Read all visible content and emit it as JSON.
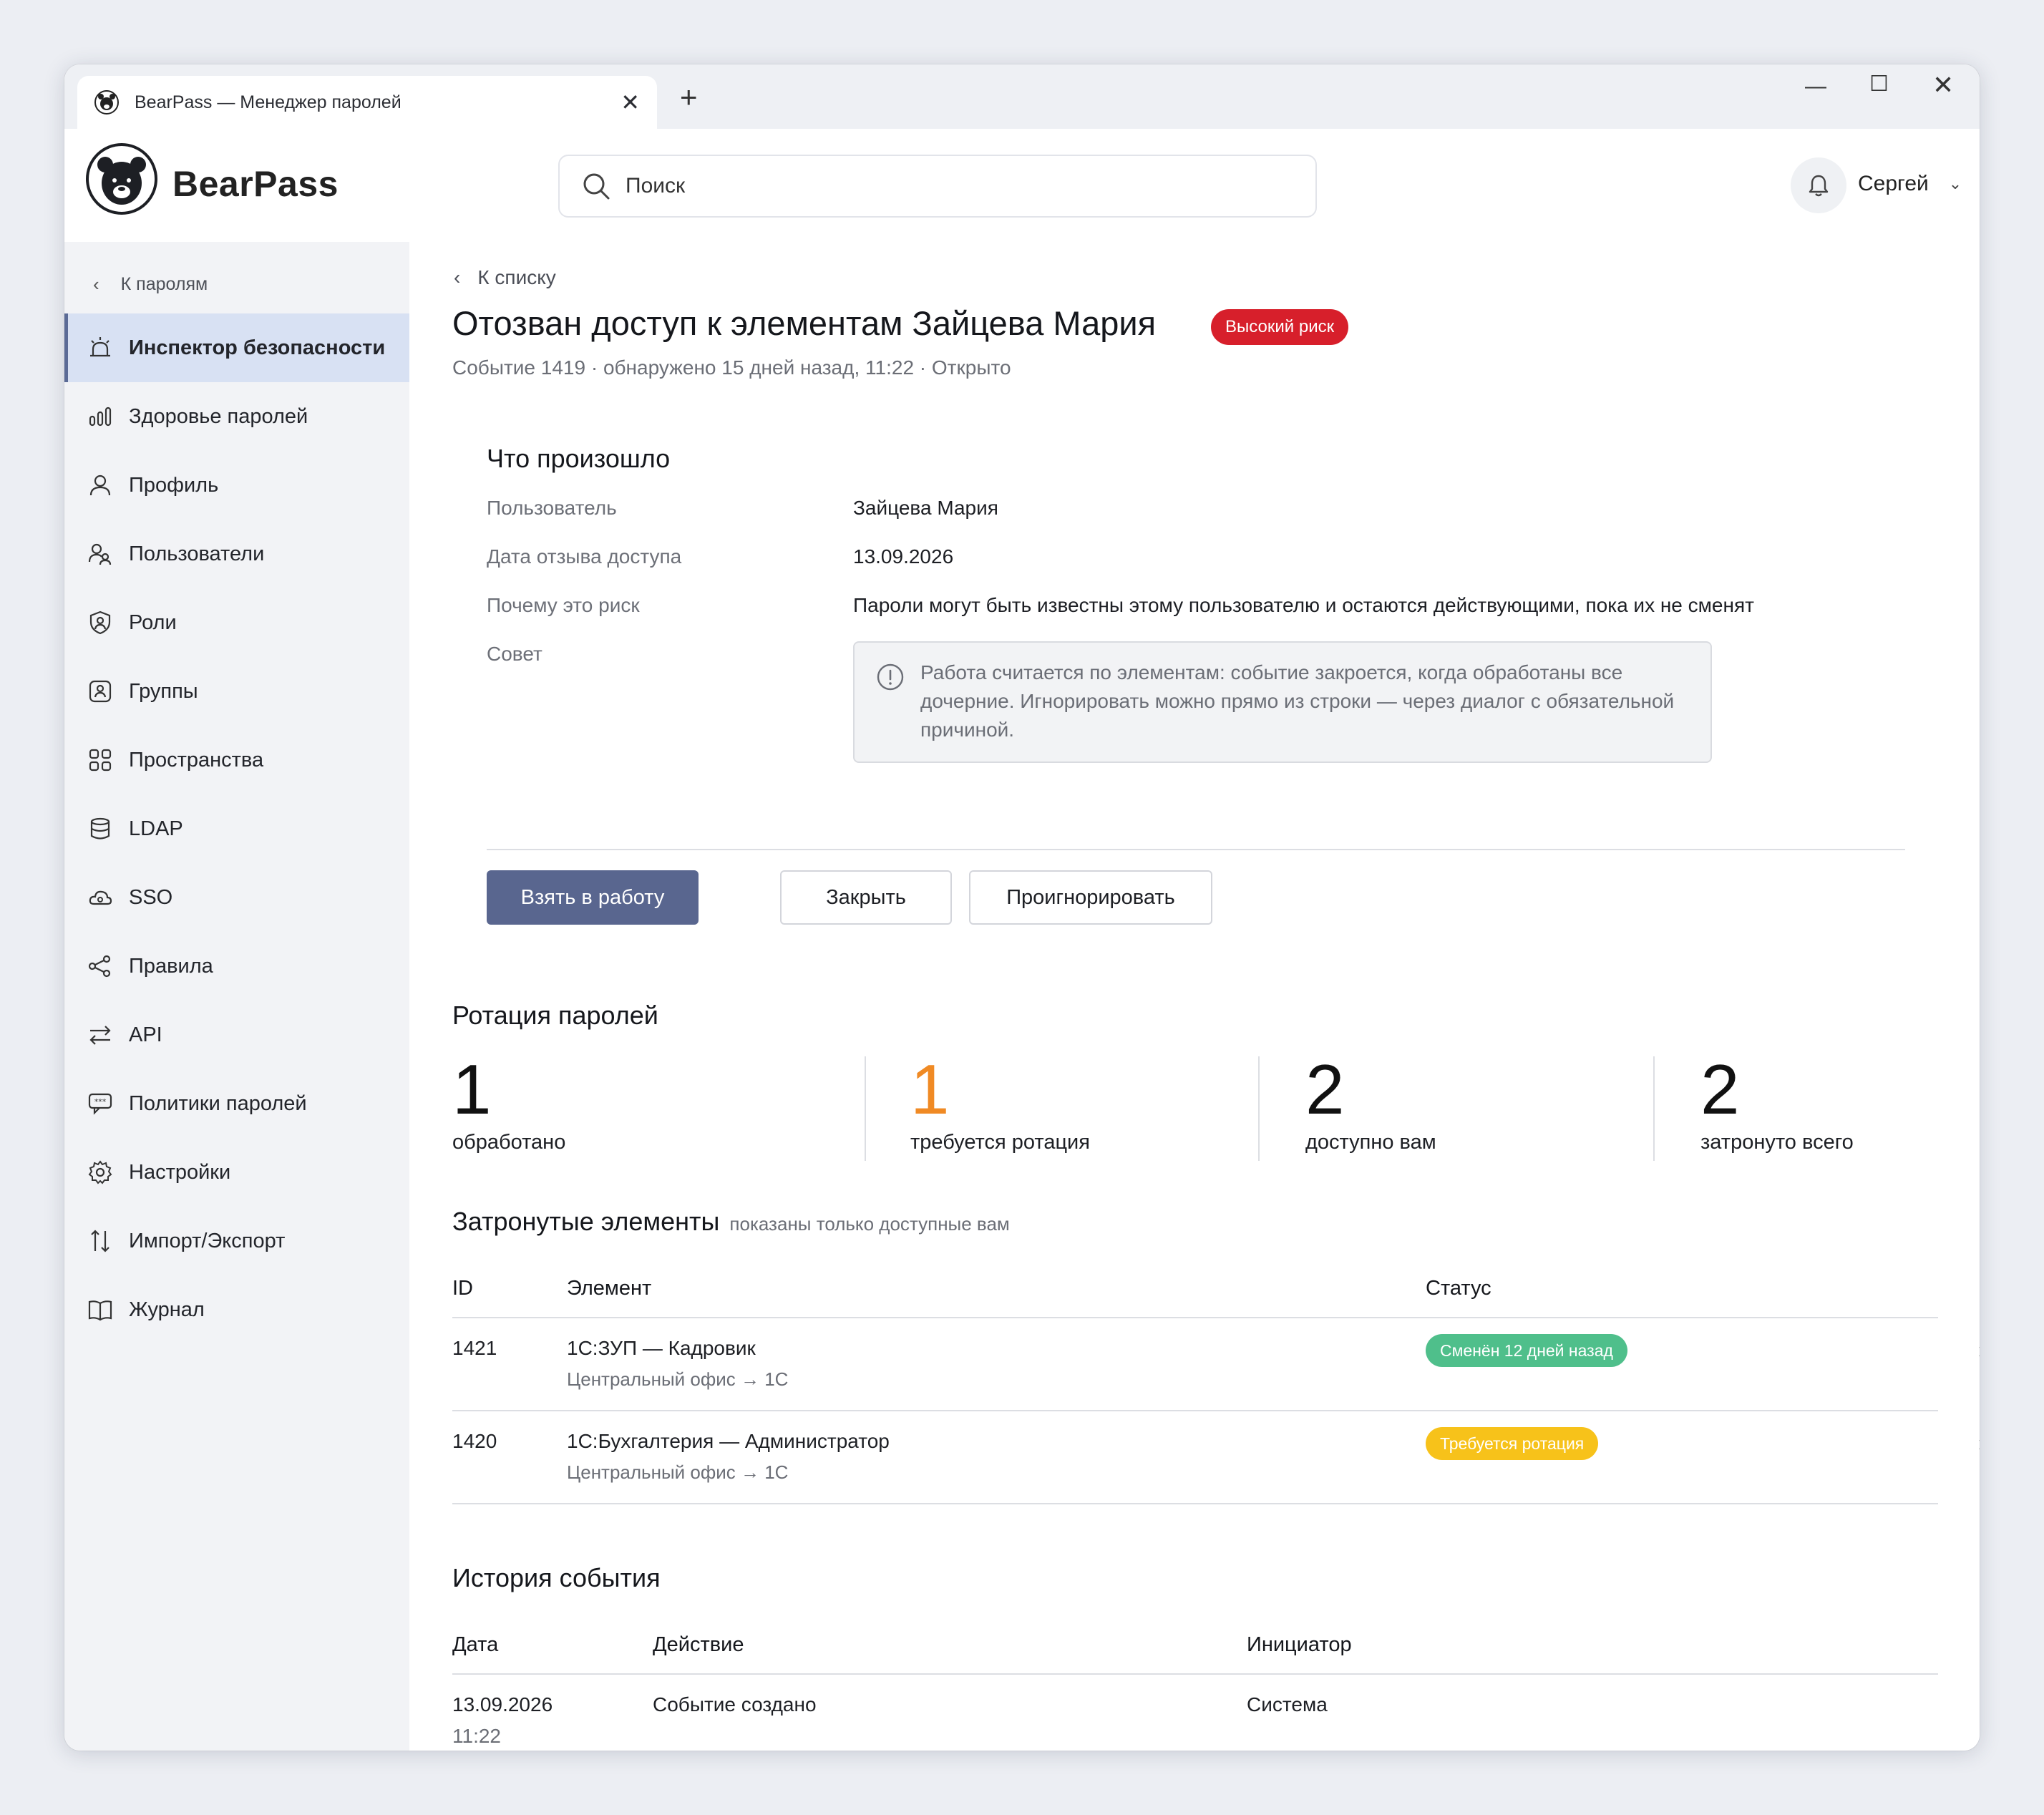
{
  "window": {
    "tab_title": "BearPass — Менеджер паролей",
    "tab_close": "✕",
    "new_tab": "+",
    "minimize": "—",
    "maximize": "☐",
    "close": "✕"
  },
  "header": {
    "brand": "BearPass",
    "search_placeholder": "Поиск",
    "user_name": "Сергей",
    "user_chevron": "⌄"
  },
  "sidebar": {
    "back_label": "К паролям",
    "items": [
      {
        "label": "Инспектор безопасности",
        "icon": "alarm-icon",
        "active": true
      },
      {
        "label": "Здоровье паролей",
        "icon": "bar-chart-icon"
      },
      {
        "label": "Профиль",
        "icon": "user-icon"
      },
      {
        "label": "Пользователи",
        "icon": "users-icon"
      },
      {
        "label": "Роли",
        "icon": "shield-user-icon"
      },
      {
        "label": "Группы",
        "icon": "group-icon"
      },
      {
        "label": "Пространства",
        "icon": "grid-icon"
      },
      {
        "label": "LDAP",
        "icon": "database-icon"
      },
      {
        "label": "SSO",
        "icon": "cloud-icon"
      },
      {
        "label": "Правила",
        "icon": "share-icon"
      },
      {
        "label": "API",
        "icon": "swap-icon"
      },
      {
        "label": "Политики паролей",
        "icon": "chat-password-icon"
      },
      {
        "label": "Настройки",
        "icon": "gear-icon"
      },
      {
        "label": "Импорт/Экспорт",
        "icon": "import-export-icon"
      },
      {
        "label": "Журнал",
        "icon": "book-icon"
      }
    ]
  },
  "event": {
    "back_label": "К списку",
    "title": "Отозван доступ к элементам Зайцева Мария",
    "risk_badge": "Высокий риск",
    "meta": "Событие 1419 · обнаружено 15 дней назад, 11:22 · Открыто",
    "what_happened": {
      "heading": "Что произошло",
      "user_label": "Пользователь",
      "user_value": "Зайцева Мария",
      "date_label": "Дата отзыва доступа",
      "date_value": "13.09.2026",
      "why_label": "Почему это риск",
      "why_value": "Пароли могут быть известны этому пользователю и остаются действующими, пока их не сменят",
      "advice_label": "Совет",
      "advice_text": "Работа считается по элементам: событие закроется, когда обработаны все дочерние. Игнорировать можно прямо из строки — через диалог с обязательной причиной."
    },
    "actions": {
      "take": "Взять в работу",
      "close": "Закрыть",
      "ignore": "Проигнорировать"
    }
  },
  "rotation": {
    "heading": "Ротация паролей",
    "stats": [
      {
        "value": "1",
        "label": "обработано"
      },
      {
        "value": "1",
        "label": "требуется ротация"
      },
      {
        "value": "2",
        "label": "доступно вам"
      },
      {
        "value": "2",
        "label": "затронуто всего"
      }
    ],
    "accent_color": "#f08a24"
  },
  "affected": {
    "heading": "Затронутые элементы",
    "hint": "показаны только доступные вам",
    "columns": {
      "id": "ID",
      "element": "Элемент",
      "status": "Статус"
    },
    "rows": [
      {
        "id": "1421",
        "name": "1С:ЗУП — Кадровик",
        "path": "Центральный офис → 1С",
        "status": "Сменён 12 дней назад",
        "status_color": "#4fbf8b"
      },
      {
        "id": "1420",
        "name": "1С:Бухгалтерия — Администратор",
        "path": "Центральный офис → 1С",
        "status": "Требуется ротация",
        "status_color": "#f7c21a"
      }
    ]
  },
  "history": {
    "heading": "История события",
    "columns": {
      "date": "Дата",
      "action": "Действие",
      "initiator": "Инициатор"
    },
    "rows": [
      {
        "date": "13.09.2026",
        "time": "11:22",
        "action": "Событие создано",
        "initiator": "Система"
      }
    ]
  },
  "colors": {
    "primary": "#59668f",
    "danger": "#d71f2b",
    "sidebar_active": "#d8e1f3"
  }
}
